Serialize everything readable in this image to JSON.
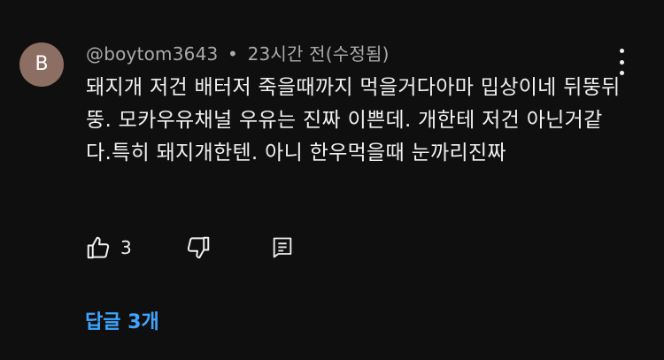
{
  "comment": {
    "avatar_letter": "B",
    "avatar_color": "#8d6e63",
    "author": "@boytom3643",
    "separator": "•",
    "time": "23시간 전(수정됨)",
    "text": "돼지개 저건 배터저 죽을때까지 먹을거다아마 밉상이네 뒤뚱뒤뚱. 모카우유채널 우유는 진짜 이쁜데. 개한테 저건 아닌거같다.특히 돼지개한텐. 아니 한우먹을때 눈까리진짜",
    "like_count": "3",
    "replies_label": "답글 3개",
    "accent_color": "#3ea6ff"
  },
  "icons": {
    "like": "thumb-up-icon",
    "dislike": "thumb-down-icon",
    "reply": "reply-comment-icon",
    "more": "more-vertical-icon"
  }
}
